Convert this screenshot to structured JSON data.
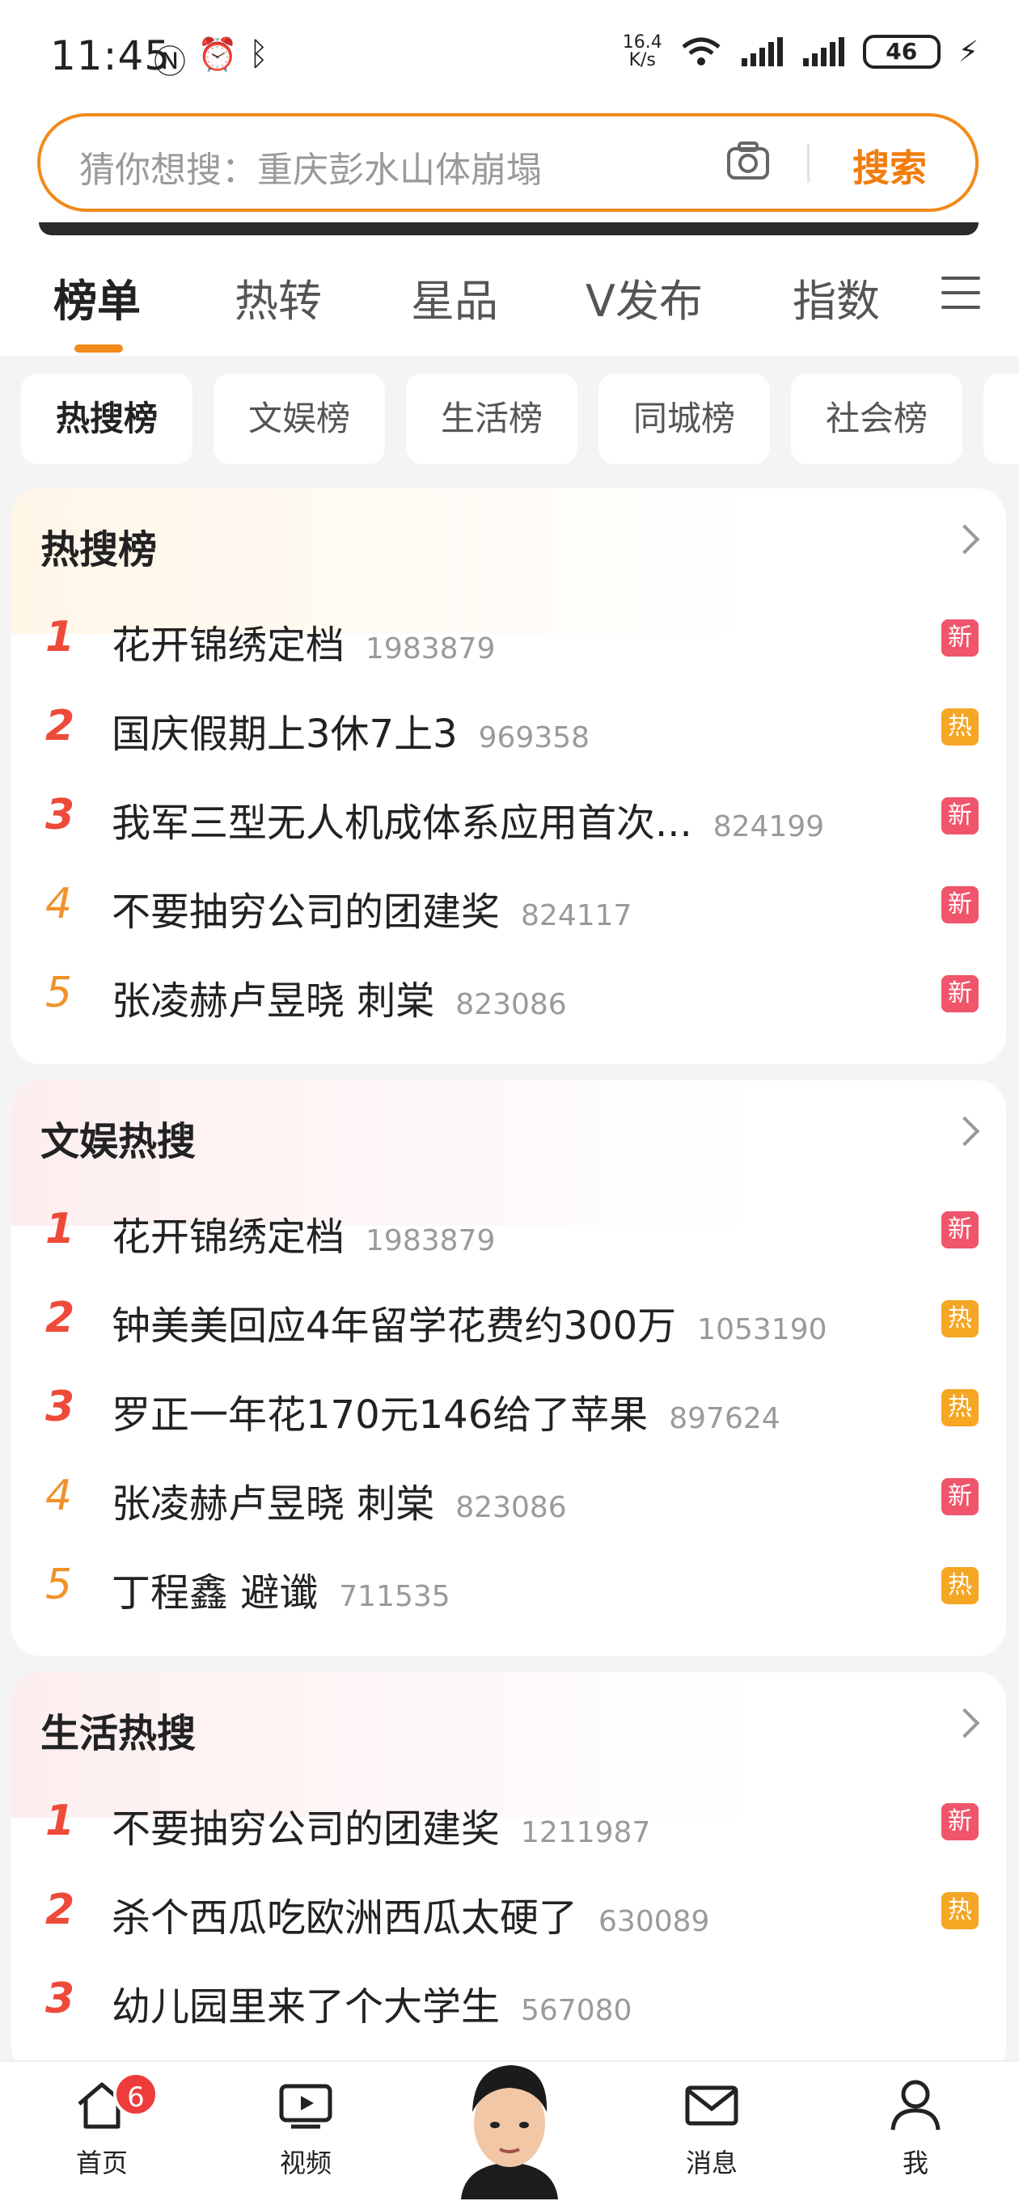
{
  "status": {
    "time": "11:45",
    "net_speed_value": "16.4",
    "net_speed_unit": "K/s",
    "battery": "46"
  },
  "search": {
    "placeholder": "猜你想搜：重庆彭水山体崩塌",
    "button_label": "搜索"
  },
  "tabs": [
    {
      "label": "榜单",
      "active": true
    },
    {
      "label": "热转"
    },
    {
      "label": "星品"
    },
    {
      "label": "V发布"
    },
    {
      "label": "指数"
    }
  ],
  "chips": [
    {
      "label": "热搜榜",
      "active": true
    },
    {
      "label": "文娱榜"
    },
    {
      "label": "生活榜"
    },
    {
      "label": "同城榜"
    },
    {
      "label": "社会榜"
    }
  ],
  "sections": [
    {
      "title": "热搜榜",
      "items": [
        {
          "rank": "1",
          "title": "花开锦绣定档",
          "count": "1983879",
          "badge": "新"
        },
        {
          "rank": "2",
          "title": "国庆假期上3休7上3",
          "count": "969358",
          "badge": "热"
        },
        {
          "rank": "3",
          "title": "我军三型无人机成体系应用首次...",
          "count": "824199",
          "badge": "新"
        },
        {
          "rank": "4",
          "title": "不要抽穷公司的团建奖",
          "count": "824117",
          "badge": "新"
        },
        {
          "rank": "5",
          "title": "张凌赫卢昱晓 刺棠",
          "count": "823086",
          "badge": "新"
        }
      ]
    },
    {
      "title": "文娱热搜",
      "items": [
        {
          "rank": "1",
          "title": "花开锦绣定档",
          "count": "1983879",
          "badge": "新"
        },
        {
          "rank": "2",
          "title": "钟美美回应4年留学花费约300万",
          "count": "1053190",
          "badge": "热"
        },
        {
          "rank": "3",
          "title": "罗正一年花170元146给了苹果",
          "count": "897624",
          "badge": "热"
        },
        {
          "rank": "4",
          "title": "张凌赫卢昱晓 刺棠",
          "count": "823086",
          "badge": "新"
        },
        {
          "rank": "5",
          "title": "丁程鑫 避谶",
          "count": "711535",
          "badge": "热"
        }
      ]
    },
    {
      "title": "生活热搜",
      "items": [
        {
          "rank": "1",
          "title": "不要抽穷公司的团建奖",
          "count": "1211987",
          "badge": "新"
        },
        {
          "rank": "2",
          "title": "杀个西瓜吃欧洲西瓜太硬了",
          "count": "630089",
          "badge": "热"
        },
        {
          "rank": "3",
          "title": "幼儿园里来了个大学生",
          "count": "567080",
          "badge": ""
        }
      ]
    }
  ],
  "nav": {
    "home": "首页",
    "home_badge": "6",
    "video": "视频",
    "messages": "消息",
    "me": "我"
  },
  "colors": {
    "accent": "#f28a1a",
    "rank_top": "#ee4a3a",
    "rank_other": "#f0922a",
    "badge_new": "#f0556b",
    "badge_hot": "#f5a623"
  }
}
